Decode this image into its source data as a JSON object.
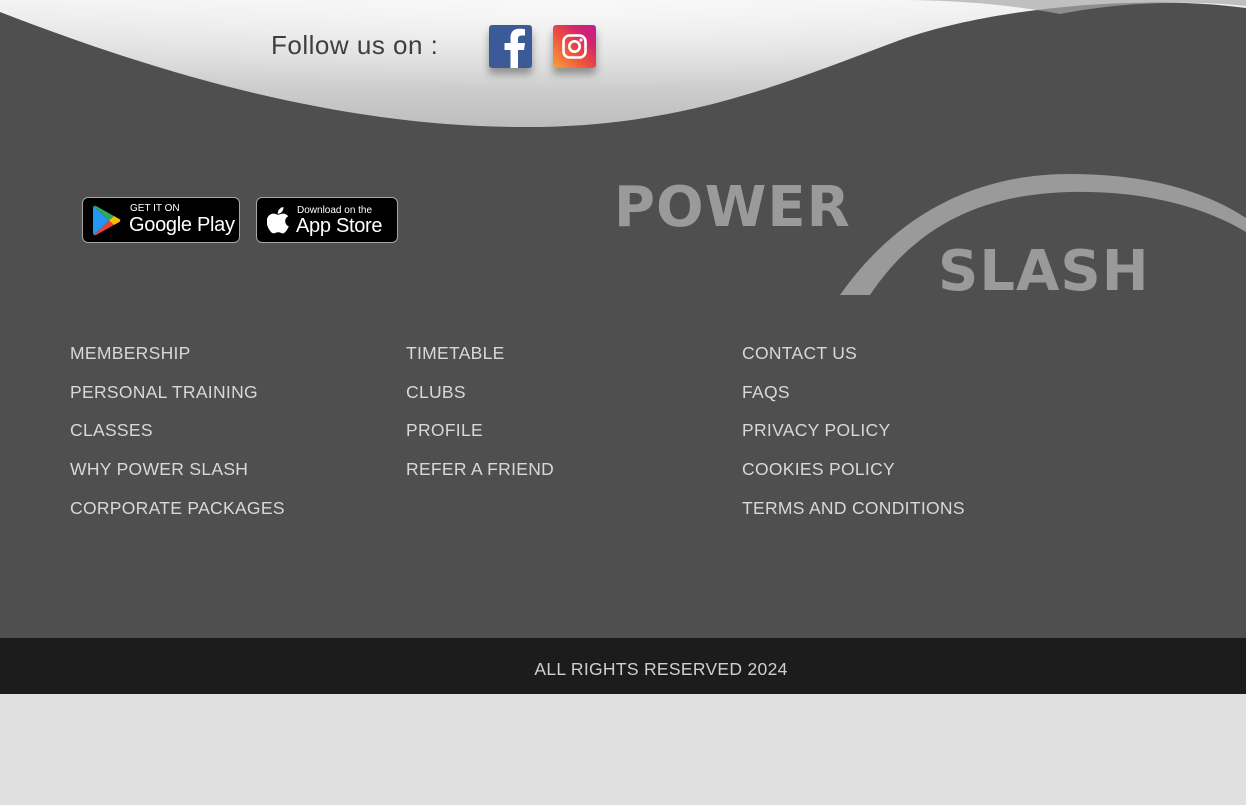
{
  "social": {
    "follow_label": "Follow us on :",
    "facebook_icon": "facebook-icon",
    "instagram_icon": "instagram-icon"
  },
  "apps": {
    "google_play": {
      "small": "GET IT ON",
      "big": "Google Play",
      "icon": "google-play-icon"
    },
    "app_store": {
      "small": "Download on the",
      "big": "App Store",
      "icon": "apple-icon"
    }
  },
  "brand": {
    "line1": "POWER",
    "line2": "SLASH"
  },
  "footer_links": {
    "col1": [
      "MEMBERSHIP",
      "PERSONAL TRAINING",
      "CLASSES",
      "WHY POWER SLASH",
      "CORPORATE PACKAGES"
    ],
    "col2": [
      "TIMETABLE",
      "CLUBS",
      "PROFILE",
      "REFER A FRIEND"
    ],
    "col3": [
      "CONTACT US",
      "FAQS",
      "PRIVACY POLICY",
      "COOKIES POLICY",
      "TERMS AND CONDITIONS"
    ]
  },
  "copyright": "ALL RIGHTS RESERVED 2024",
  "colors": {
    "footer_bg": "#4f4f4f",
    "bottom_bar_bg": "#1c1c1c",
    "page_bg": "#e0e0e0",
    "link_text": "#d8d8d8",
    "logo_gray": "#9a9a9a",
    "facebook_blue": "#3d5a98"
  }
}
